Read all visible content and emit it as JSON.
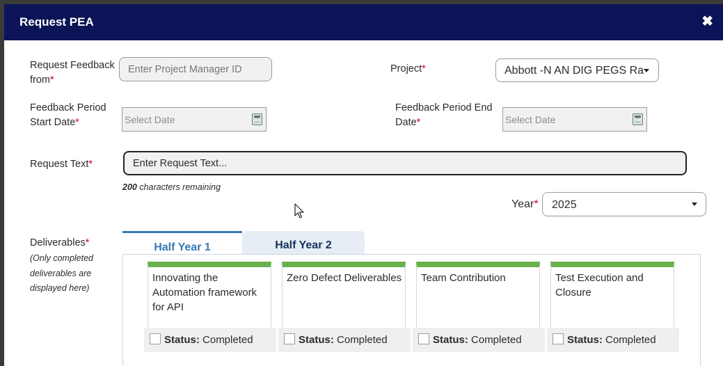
{
  "modal": {
    "title": "Request PEA",
    "close_icon": "close-icon"
  },
  "form": {
    "request_from": {
      "label": "Request Feedback from",
      "required": "*",
      "placeholder": "Enter Project Manager ID"
    },
    "project": {
      "label": "Project",
      "required": "*",
      "selected": "Abbott -N AN DIG PEGS Ra"
    },
    "start_date": {
      "label": "Feedback Period Start Date",
      "required": "*",
      "placeholder": "Select Date"
    },
    "end_date": {
      "label": "Feedback Period End Date",
      "required": "*",
      "placeholder": "Select Date"
    },
    "request_text": {
      "label": "Request Text",
      "required": "*",
      "placeholder": "Enter Request Text...",
      "chars_count": "200",
      "chars_suffix": "characters remaining"
    },
    "year": {
      "label": "Year",
      "required": "*",
      "selected": "2025"
    },
    "deliverables": {
      "label": "Deliverables",
      "required": "*",
      "note": "(Only completed deliverables are displayed here)"
    }
  },
  "tabs": [
    {
      "label": "Half Year 1",
      "active": true
    },
    {
      "label": "Half Year 2",
      "active": false
    }
  ],
  "cards": [
    {
      "title": "Innovating the Automation framework for API",
      "status_label": "Status:",
      "status": "Completed"
    },
    {
      "title": "Zero Defect Deliverables",
      "status_label": "Status:",
      "status": "Completed"
    },
    {
      "title": "Team Contribution",
      "status_label": "Status:",
      "status": "Completed"
    },
    {
      "title": "Test Execution and Closure",
      "status_label": "Status:",
      "status": "Completed"
    }
  ],
  "colors": {
    "header": "#0b1456",
    "accent": "#3a78b5",
    "card_bar": "#6ab04c",
    "required": "#d0021b"
  }
}
